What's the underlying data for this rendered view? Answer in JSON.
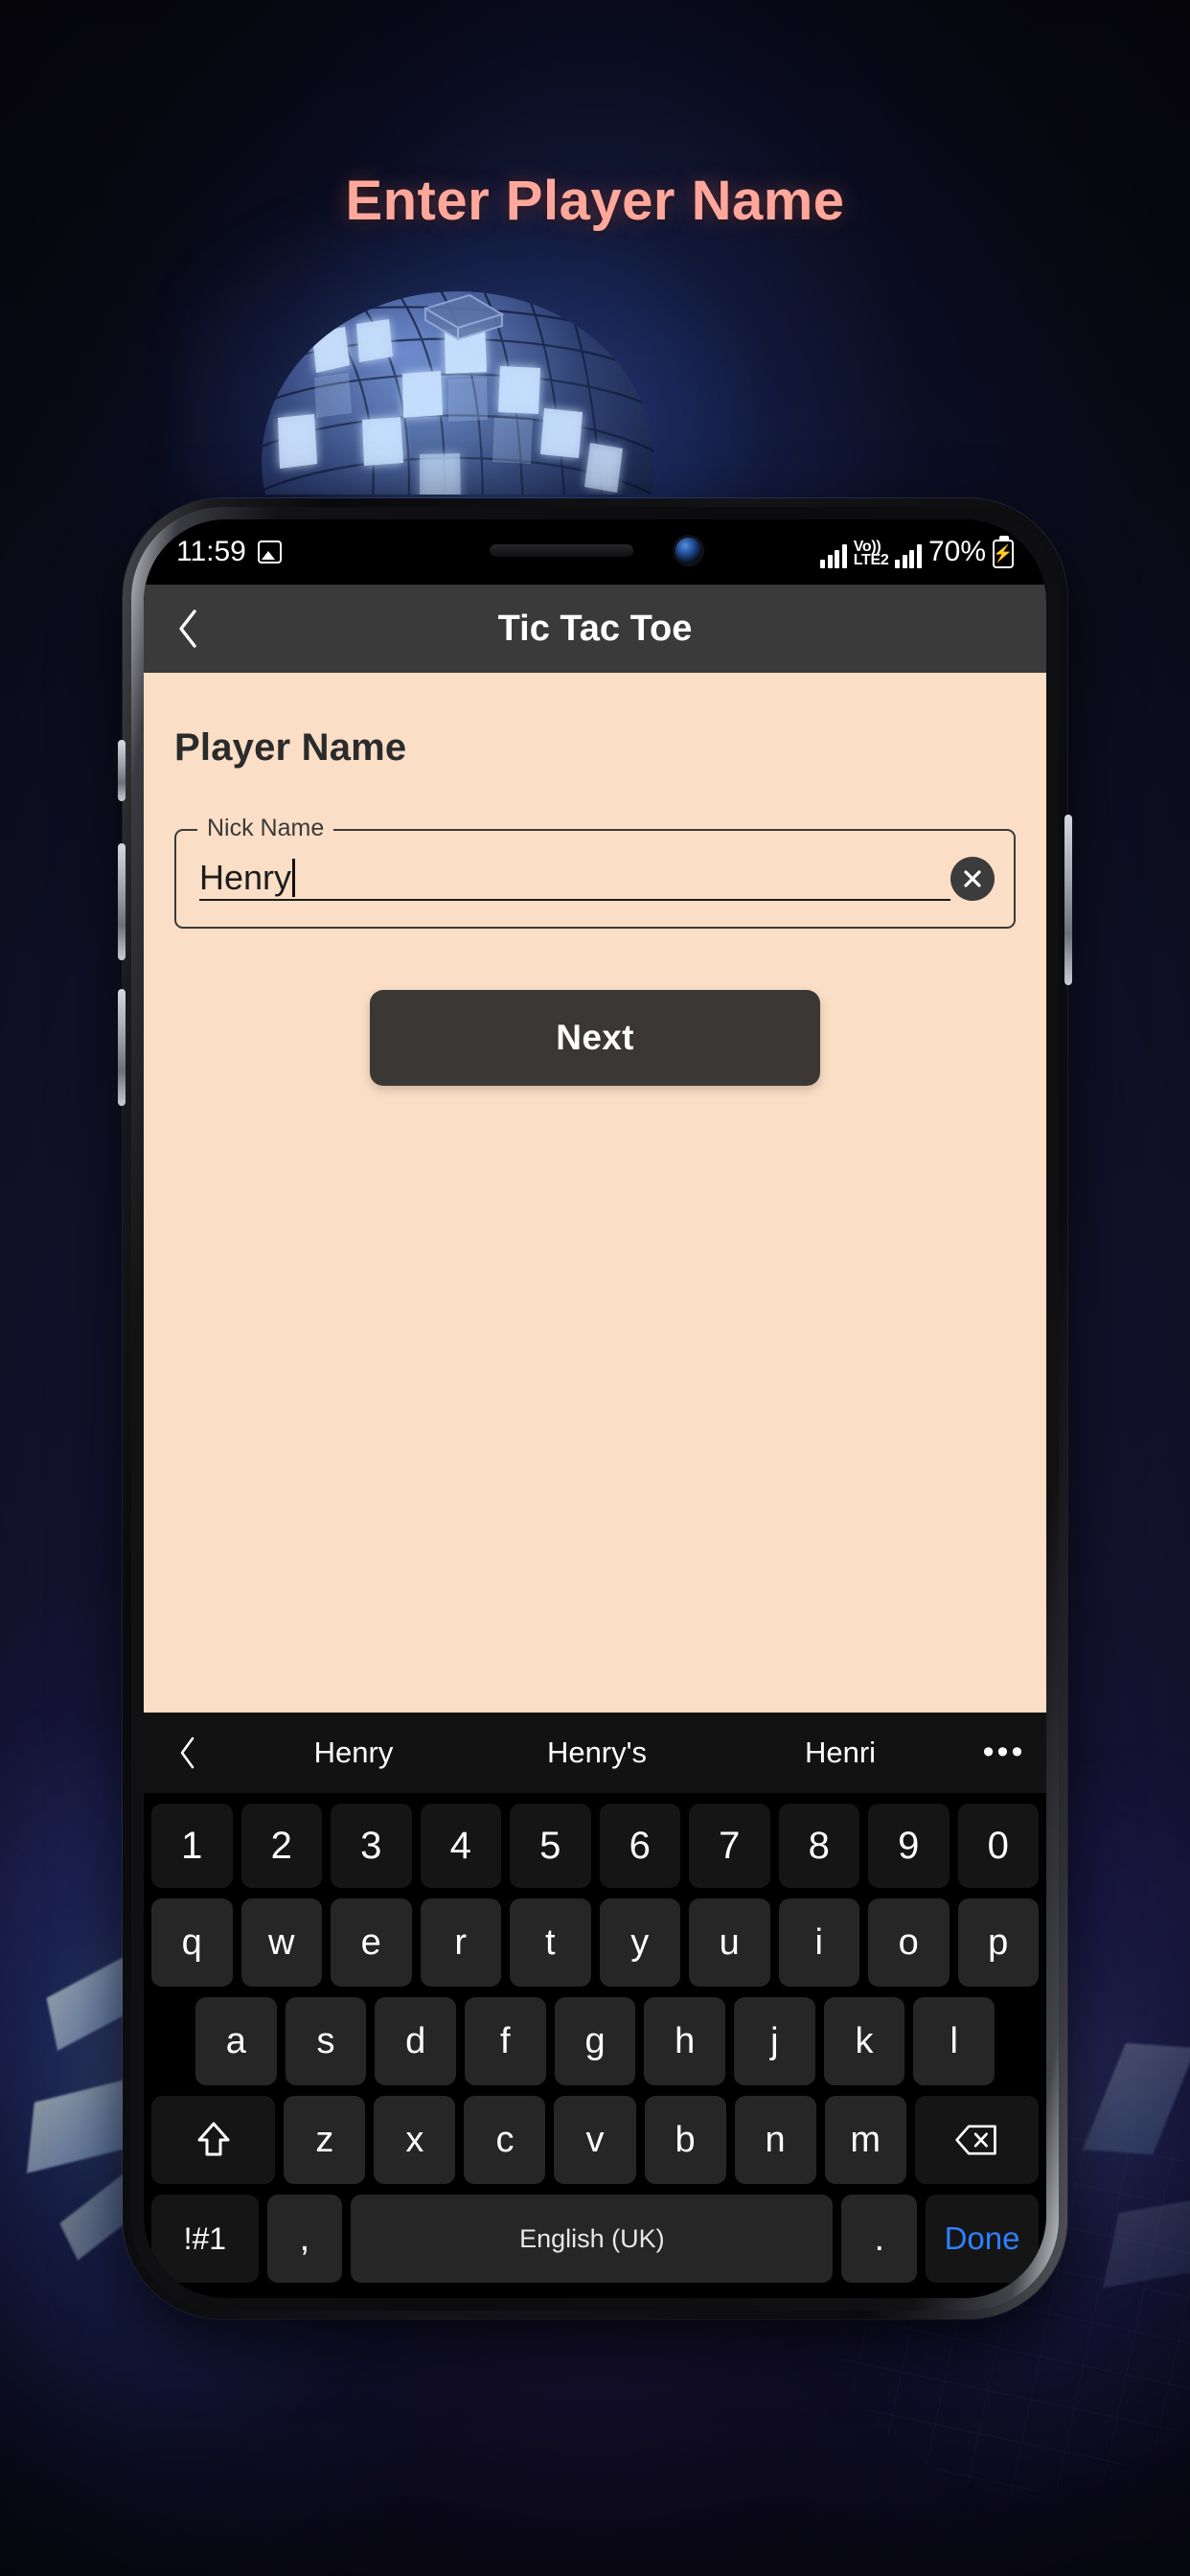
{
  "page": {
    "headline": "Enter Player Name",
    "headline_color": "#ffa79a",
    "background_accent": "#1d1740"
  },
  "decoration": {
    "disco_ball": "disco-ball-graphic"
  },
  "phone": {
    "status_bar": {
      "time": "11:59",
      "image_icon": "image-icon",
      "network_label_top": "Vo))",
      "network_label_bottom": "LTE2",
      "battery_percent": "70%",
      "battery_state": "charging"
    },
    "app_bar": {
      "back_icon": "chevron-left-icon",
      "title": "Tic Tac Toe",
      "background": "#3a3a3a"
    },
    "content": {
      "background": "#fadec5",
      "heading": "Player Name",
      "field": {
        "label": "Nick Name",
        "value": "Henry",
        "placeholder": "Nick Name",
        "clear_icon": "close-circle-icon"
      },
      "next_button": "Next"
    },
    "keyboard": {
      "suggestions_back_icon": "chevron-left-icon",
      "suggestions": [
        "Henry",
        "Henry's",
        "Henri"
      ],
      "more_icon": "overflow-dots-icon",
      "number_row": [
        "1",
        "2",
        "3",
        "4",
        "5",
        "6",
        "7",
        "8",
        "9",
        "0"
      ],
      "row_qwerty": [
        "q",
        "w",
        "e",
        "r",
        "t",
        "y",
        "u",
        "i",
        "o",
        "p"
      ],
      "row_asdf": [
        "a",
        "s",
        "d",
        "f",
        "g",
        "h",
        "j",
        "k",
        "l"
      ],
      "row_zxcv": [
        "z",
        "x",
        "c",
        "v",
        "b",
        "n",
        "m"
      ],
      "shift_icon": "shift-up-icon",
      "backspace_icon": "backspace-icon",
      "symbols_key": "!#1",
      "comma_key": ",",
      "space_key": "English (UK)",
      "period_key": ".",
      "done_key": "Done",
      "done_color": "#2f80ff"
    }
  }
}
